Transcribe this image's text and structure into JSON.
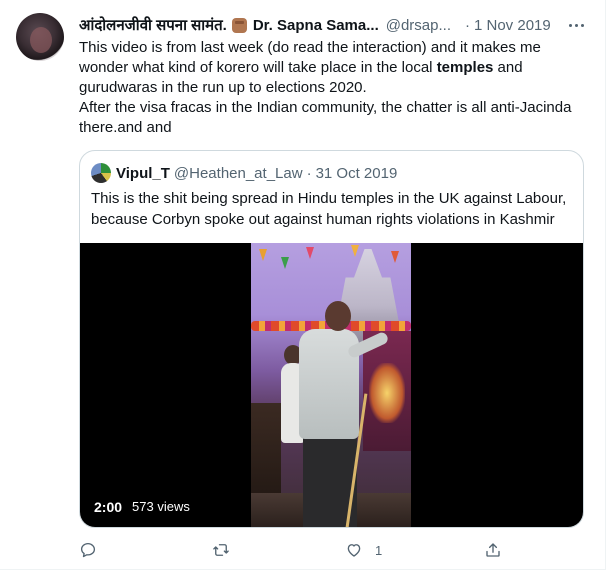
{
  "tweet": {
    "display_name": "आंदोलनजीवी सपना सामंत.",
    "display_name_2": "Dr. Sapna Sama...",
    "handle": "@drsap...",
    "separator": "·",
    "date": "1 Nov 2019",
    "text": {
      "line1": "This video is from last week (do read the interaction) and it makes me",
      "line2_a": "wonder what kind of korero will take place in the local ",
      "line2_bold": "temples",
      "line2_b": " and",
      "line3": "gurudwaras in the run up to elections 2020.",
      "line4": "After the visa fracas in the Indian community, the chatter is all anti-Jacinda",
      "line5": "there.and and"
    }
  },
  "quote": {
    "name": "Vipul_T",
    "handle": "@Heathen_at_Law",
    "separator": "·",
    "date": "31 Oct 2019",
    "text": {
      "line1": "This is the shit being spread in Hindu temples in the UK against Labour,",
      "line2": "because Corbyn spoke out against human rights violations in Kashmir"
    },
    "video": {
      "duration": "2:00",
      "views": "573 views"
    }
  },
  "actions": {
    "reply_icon": "reply-icon",
    "retweet_icon": "retweet-icon",
    "like_icon": "heart-icon",
    "like_count": "1",
    "share_icon": "share-icon"
  },
  "colors": {
    "text": "#0f1419",
    "secondary": "#536471",
    "border": "#cfd9de"
  }
}
